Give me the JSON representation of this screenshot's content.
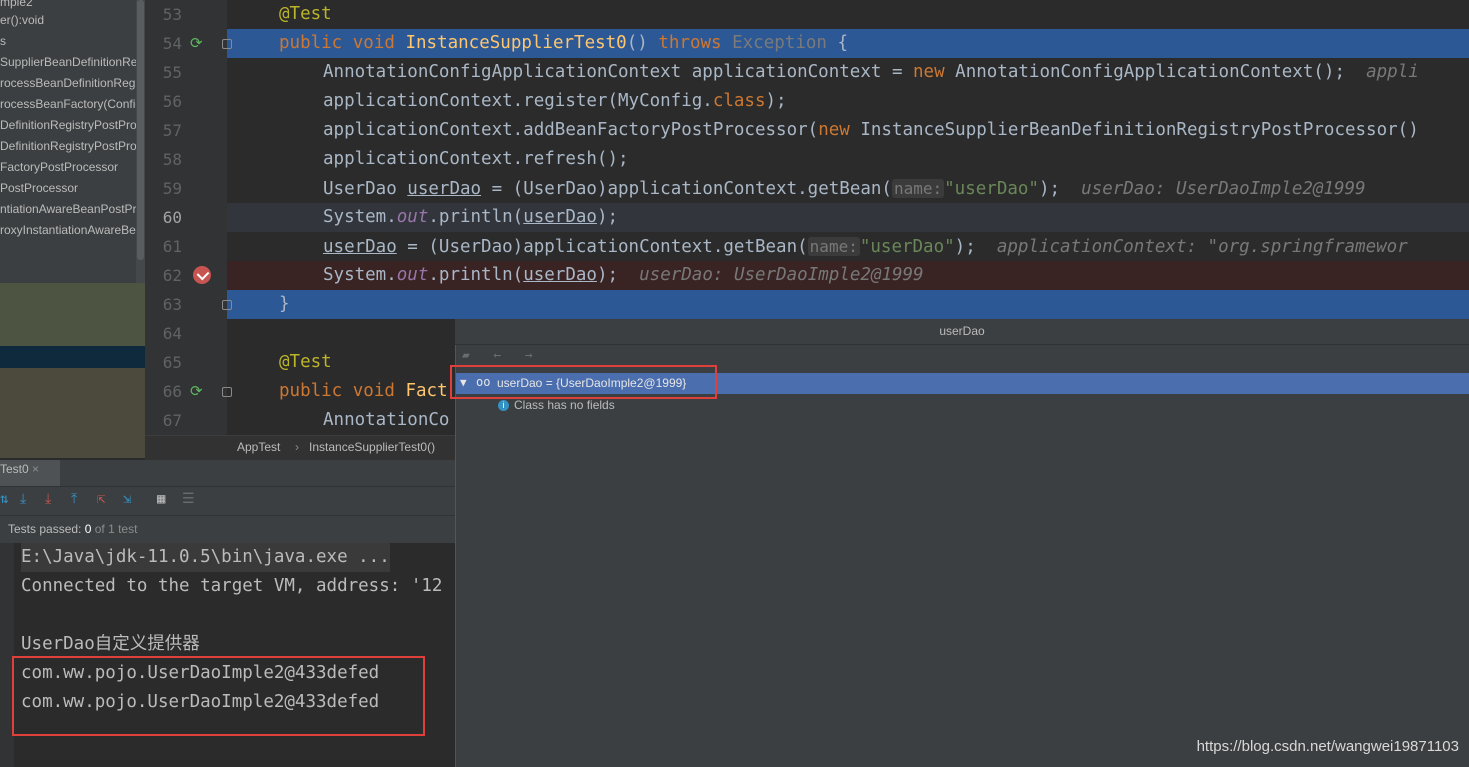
{
  "colors": {
    "editor_bg": "#2b2b2b",
    "current_line": "#32353b",
    "execution_line": "#2d5896",
    "breakpoint_line": "#3a2323",
    "selection": "#4b6eaf",
    "highlight_box": "#e0403c"
  },
  "project_tree": {
    "items": [
      "mple2",
      "er():void",
      "s",
      "SupplierBeanDefinitionReg",
      "rocessBeanDefinitionRegi",
      "rocessBeanFactory(Config",
      "DefinitionRegistryPostPro",
      "DefinitionRegistryPostPro",
      "FactoryPostProcessor",
      "PostProcessor",
      "ntiationAwareBeanPostPr",
      "roxyInstantiationAwareBe"
    ]
  },
  "editor": {
    "line_numbers": [
      "53",
      "54",
      "55",
      "56",
      "57",
      "58",
      "59",
      "60",
      "61",
      "62",
      "63",
      "64",
      "65",
      "66",
      "67"
    ],
    "lines": {
      "l53_annotation": "@Test",
      "l54_kw_public": "public",
      "l54_kw_void": "void",
      "l54_method": "InstanceSupplierTest0",
      "l54_paren": "() ",
      "l54_kw_throws": "throws",
      "l54_exception": "Exception",
      "l54_brace": " {",
      "l55_code": "AnnotationConfigApplicationContext applicationContext = ",
      "l55_kw_new": "new",
      "l55_code2": " AnnotationConfigApplicationContext();",
      "l55_hint": "appli",
      "l56_code": "applicationContext.register(MyConfig.",
      "l56_kw_class": "class",
      "l56_end": ");",
      "l57_code": "applicationContext.addBeanFactoryPostProcessor(",
      "l57_kw_new": "new",
      "l57_code2": " InstanceSupplierBeanDefinitionRegistryPostProcessor()",
      "l58_code": "applicationContext.refresh();",
      "l59_code": "UserDao ",
      "l59_var": "userDao",
      "l59_code2": " = (UserDao)applicationContext.getBean(",
      "l59_param": "name:",
      "l59_str": "\"userDao\"",
      "l59_end": ");",
      "l59_hint": "userDao: UserDaoImple2@1999",
      "l60_code": "System.",
      "l60_field": "out",
      "l60_code2": ".println(",
      "l60_var": "userDao",
      "l60_end": ");",
      "l61_var": "userDao",
      "l61_code": " = (UserDao)applicationContext.getBean(",
      "l61_param": "name:",
      "l61_str": "\"userDao\"",
      "l61_end": ");",
      "l61_hint": "applicationContext: \"org.springframewor",
      "l62_code": "System.",
      "l62_field": "out",
      "l62_code2": ".println(",
      "l62_var": "userDao",
      "l62_end": ");",
      "l62_hint": "userDao: UserDaoImple2@1999",
      "l63_brace": "}",
      "l65_annotation": "@Test",
      "l66_kw_public": "public",
      "l66_kw_void": "void",
      "l66_method": "Fact",
      "l67_code": "AnnotationCo"
    }
  },
  "breadcrumb": {
    "class_name": "AppTest",
    "separator": "›",
    "method_name": "InstanceSupplierTest0()"
  },
  "run_panel": {
    "tab_label": "Test0",
    "tab_close": "×",
    "status_prefix": "Tests passed: ",
    "status_count": "0",
    "status_suffix": " of 1 test",
    "console_lines": [
      "E:\\Java\\jdk-11.0.5\\bin\\java.exe ...",
      "Connected to the target VM, address: '12",
      "",
      "UserDao自定义提供器",
      "com.ww.pojo.UserDaoImple2@433defed",
      "com.ww.pojo.UserDaoImple2@433defed"
    ]
  },
  "popup": {
    "title": "userDao",
    "root_node": "userDao = {UserDaoImple2@1999}",
    "child_node": "Class has no fields"
  },
  "watermark": "https://blog.csdn.net/wangwei19871103"
}
